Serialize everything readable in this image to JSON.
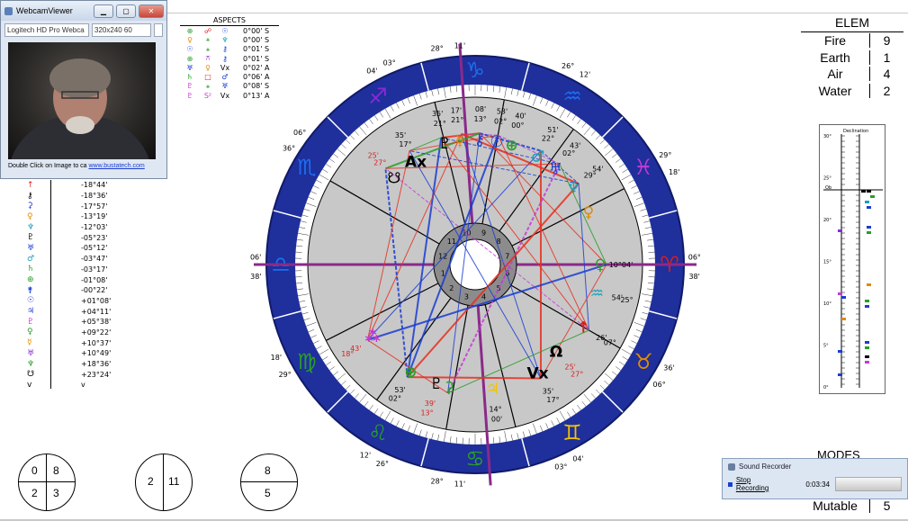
{
  "webcam": {
    "title": "WebcamViewer",
    "device": "Logitech HD Pro Webca",
    "resolution": "320x240 60",
    "caption_text": "Double Click on Image to ca",
    "caption_link": "www.bustatech.com"
  },
  "aspects": {
    "header": "ASPECTS",
    "rows": [
      {
        "p1": "⊕",
        "c1": "#2a9d2a",
        "asp": "☍",
        "ca": "#d62020",
        "p2": "☉",
        "c2": "#1a3dd1",
        "val": "0°00' S"
      },
      {
        "p1": "♀",
        "c1": "#e08a00",
        "asp": "⚹",
        "ca": "#2a9d2a",
        "p2": "♆",
        "c2": "#1aa0b8",
        "val": "0°00' S"
      },
      {
        "p1": "☉",
        "c1": "#1a3dd1",
        "asp": "⚹",
        "ca": "#2a9d2a",
        "p2": "⚷",
        "c2": "#1a3dd1",
        "val": "0°01' S"
      },
      {
        "p1": "⊕",
        "c1": "#2a9d2a",
        "asp": "⚻",
        "ca": "#8a2ad6",
        "p2": "⚷",
        "c2": "#1a3dd1",
        "val": "0°01' S"
      },
      {
        "p1": "♅",
        "c1": "#1a3dd1",
        "asp": "♀",
        "ca": "#e08a00",
        "p2": "Vx",
        "c2": "#000000",
        "val": "0°02' A"
      },
      {
        "p1": "♄",
        "c1": "#2a9d2a",
        "asp": "□",
        "ca": "#d62020",
        "p2": "♂",
        "c2": "#1a3dd1",
        "val": "0°06' A"
      },
      {
        "p1": "♇",
        "c1": "#c33bd6",
        "asp": "⚹",
        "ca": "#2a9d2a",
        "p2": "♅",
        "c2": "#1a3dd1",
        "val": "0°08' S"
      },
      {
        "p1": "♇",
        "c1": "#c33bd6",
        "asp": "S²",
        "ca": "#c33bd6",
        "p2": "Vx",
        "c2": "#000000",
        "val": "0°13' A"
      }
    ]
  },
  "declinations": [
    {
      "sym": "↑",
      "color": "#d62020",
      "val": "-18°44'"
    },
    {
      "sym": "⚷",
      "color": "#000000",
      "val": "-18°36'"
    },
    {
      "sym": "⚳",
      "color": "#1a3dd1",
      "val": "-17°57'"
    },
    {
      "sym": "♀",
      "color": "#e08a00",
      "val": "-13°19'"
    },
    {
      "sym": "♆",
      "color": "#1aa0b8",
      "val": "-12°03'"
    },
    {
      "sym": "♇",
      "color": "#000000",
      "val": "-05°23'"
    },
    {
      "sym": "♅",
      "color": "#1a3dd1",
      "val": "-05°12'"
    },
    {
      "sym": "♂",
      "color": "#1aa0b8",
      "val": "-03°47'"
    },
    {
      "sym": "♄",
      "color": "#2a9d2a",
      "val": "-03°17'"
    },
    {
      "sym": "⊕",
      "color": "#2a9d2a",
      "val": "-01°08'"
    },
    {
      "sym": "⚵",
      "color": "#1a3dd1",
      "val": "-00°22'"
    },
    {
      "sym": "☉",
      "color": "#1a3dd1",
      "val": "+01°08'"
    },
    {
      "sym": "♃",
      "color": "#1a3dd1",
      "val": "+04°11'"
    },
    {
      "sym": "♇",
      "color": "#c33bd6",
      "val": "+05°38'"
    },
    {
      "sym": "♀",
      "color": "#2a9d2a",
      "val": "+09°22'"
    },
    {
      "sym": "☿",
      "color": "#e08a00",
      "val": "+10°37'"
    },
    {
      "sym": "♅",
      "color": "#8a2ad6",
      "val": "+10°49'"
    },
    {
      "sym": "♆",
      "color": "#2a9d2a",
      "val": "+18°36'"
    },
    {
      "sym": "☋",
      "color": "#000000",
      "val": "+23°24'"
    },
    {
      "sym": "v",
      "color": "#000000",
      "val": "v"
    }
  ],
  "elements": {
    "header": "ELEM",
    "rows": [
      {
        "name": "Fire",
        "value": "9"
      },
      {
        "name": "Earth",
        "value": "1"
      },
      {
        "name": "Air",
        "value": "4"
      },
      {
        "name": "Water",
        "value": "2"
      }
    ]
  },
  "declination_chart": {
    "title": "Declination",
    "ticks": [
      "30°",
      "25°",
      "20°",
      "15°",
      "10°",
      "5°",
      "0°"
    ],
    "oob": "Ob"
  },
  "modes": {
    "header": "MODES",
    "rows": [
      {
        "name": "Mutable",
        "value": "5"
      }
    ]
  },
  "sound_recorder": {
    "title": "Sound Recorder",
    "stop_label": "Stop Recording",
    "time": "0:03:34"
  },
  "house_circles": [
    {
      "tl": "0",
      "tr": "8",
      "bl": "2",
      "br": "3"
    },
    {
      "l": "2",
      "r": "11"
    },
    {
      "top": "8",
      "bottom": "5"
    }
  ],
  "wheel": {
    "signs": [
      {
        "glyph": "♓",
        "color": "#c33bd6"
      },
      {
        "glyph": "♒",
        "color": "#1a6ff0"
      },
      {
        "glyph": "♑",
        "color": "#1a6ff0"
      },
      {
        "glyph": "♐",
        "color": "#8a2ad6"
      },
      {
        "glyph": "♏",
        "color": "#1a6ff0"
      },
      {
        "glyph": "♎",
        "color": "#1a6ff0"
      },
      {
        "glyph": "♍",
        "color": "#2a9d2a"
      },
      {
        "glyph": "♌",
        "color": "#2a9d2a"
      },
      {
        "glyph": "♋",
        "color": "#2a9d2a"
      },
      {
        "glyph": "♊",
        "color": "#f0c400"
      },
      {
        "glyph": "♉",
        "color": "#e08a00"
      },
      {
        "glyph": "♈",
        "color": "#d62020"
      }
    ],
    "cusp_labels": [
      {
        "text": "28°",
        "a": 100
      },
      {
        "text": "11'",
        "a": 94
      },
      {
        "text": "26°",
        "a": 65
      },
      {
        "text": "12'",
        "a": 60
      },
      {
        "text": "29°",
        "a": 30
      },
      {
        "text": "18'",
        "a": 25
      },
      {
        "text": "06°",
        "a": 2
      },
      {
        "text": "38'",
        "a": -3
      },
      {
        "text": "36'",
        "a": -28
      },
      {
        "text": "06°",
        "a": -33
      },
      {
        "text": "04'",
        "a": -62
      },
      {
        "text": "03°",
        "a": -67
      },
      {
        "text": "28°",
        "a": -100
      },
      {
        "text": "11'",
        "a": -94
      },
      {
        "text": "26°",
        "a": -115
      },
      {
        "text": "12'",
        "a": -120
      },
      {
        "text": "29°",
        "a": -150
      },
      {
        "text": "18'",
        "a": -155
      },
      {
        "text": "06'",
        "a": 178
      },
      {
        "text": "38'",
        "a": 183
      },
      {
        "text": "36°",
        "a": 148
      },
      {
        "text": "06°",
        "a": 143
      },
      {
        "text": "04'",
        "a": 118
      },
      {
        "text": "03°",
        "a": 113
      }
    ],
    "house_numbers": [
      "1",
      "2",
      "3",
      "4",
      "5",
      "6",
      "7",
      "8",
      "9",
      "10",
      "11",
      "12"
    ],
    "planets": [
      {
        "glyph": "♇",
        "color": "#000000",
        "a": 104,
        "r": 139,
        "deg": "21°",
        "min": "35'",
        "dc": "#000"
      },
      {
        "glyph": "☿",
        "color": "#e08a00",
        "a": 97,
        "r": 139,
        "deg": "21°",
        "min": "17'",
        "dc": "#000"
      },
      {
        "glyph": "⚷",
        "color": "#1a3dd1",
        "a": 88,
        "r": 139,
        "deg": "13°",
        "min": "08'",
        "dc": "#000"
      },
      {
        "glyph": "☉",
        "color": "#1a3dd1",
        "a": 80,
        "r": 139,
        "deg": "02°",
        "min": "53'",
        "dc": "#000"
      },
      {
        "glyph": "⊕",
        "color": "#2a9d2a",
        "a": 73,
        "r": 139,
        "deg": "00°",
        "min": "40'",
        "dc": "#000"
      },
      {
        "glyph": "♂",
        "color": "#1aa0b8",
        "a": 60,
        "r": 139,
        "deg": "22°",
        "min": "51'",
        "dc": "#000"
      },
      {
        "glyph": "♅",
        "color": "#1a3dd1",
        "a": 50,
        "r": 139,
        "deg": "02°",
        "min": "43'",
        "dc": "#000"
      },
      {
        "glyph": "♆",
        "color": "#1aa0b8",
        "a": 38,
        "r": 139,
        "deg": "29°",
        "min": "54'",
        "dc": "#000"
      },
      {
        "glyph": "♀",
        "color": "#e08a00",
        "a": 25,
        "r": 139,
        "deg": "",
        "min": "",
        "dc": "#000"
      },
      {
        "glyph": "♀",
        "color": "#2a9d2a",
        "a": 0,
        "r": 139,
        "deg": "10°04'",
        "min": "",
        "dc": "#000"
      },
      {
        "glyph": "♒",
        "color": "#1aa0b8",
        "a": -13,
        "r": 139,
        "deg": "54'",
        "min": "25°",
        "dc": "#000"
      },
      {
        "glyph": "↑",
        "color": "#d62020",
        "a": -30,
        "r": 139,
        "deg": "26'",
        "min": "07°",
        "dc": "#000"
      },
      {
        "glyph": "Ω",
        "color": "#000000",
        "a": -47,
        "r": 132,
        "deg": "25'",
        "min": "27°",
        "dc": "#d62020"
      },
      {
        "glyph": "Vx",
        "color": "#000000",
        "a": -60,
        "r": 139,
        "deg": "35'",
        "min": "17°",
        "dc": "#000"
      },
      {
        "glyph": "♃",
        "color": "#f0c400",
        "a": -82,
        "r": 139,
        "deg": "14°",
        "min": "00'",
        "dc": "#000"
      },
      {
        "glyph": "⚳",
        "color": "#2a9d2a",
        "a": -102,
        "r": 139,
        "deg": "",
        "min": "",
        "dc": "#000"
      },
      {
        "glyph": "♇",
        "color": "#000000",
        "a": -108,
        "r": 139,
        "deg": "39'",
        "min": "13°",
        "dc": "#d62020"
      },
      {
        "glyph": "⊕",
        "color": "#2a9d2a",
        "a": -121,
        "r": 139,
        "deg": "53'",
        "min": "02°",
        "dc": "#000"
      },
      {
        "glyph": "⁂",
        "color": "#c33bd6",
        "a": -145,
        "r": 139,
        "deg": "43'",
        "min": "18°",
        "dc": "#d62020"
      },
      {
        "glyph": "☋",
        "color": "#000000",
        "a": 133,
        "r": 132,
        "deg": "27°",
        "min": "25'",
        "dc": "#d62020"
      },
      {
        "glyph": "Ax",
        "color": "#000000",
        "a": 120,
        "r": 132,
        "deg": "17°",
        "min": "35'",
        "dc": "#000"
      }
    ]
  }
}
